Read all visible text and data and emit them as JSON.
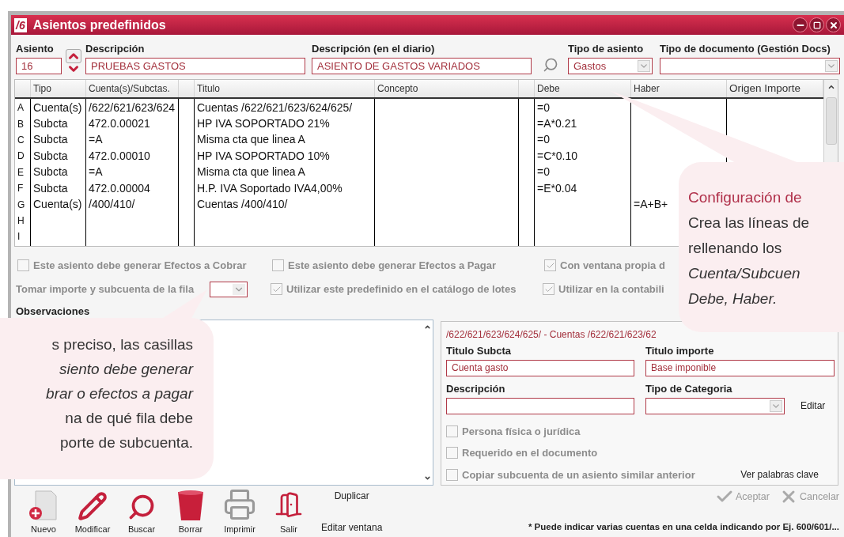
{
  "window": {
    "logo": "/6",
    "title": "Asientos predefinidos"
  },
  "header": {
    "asiento": {
      "label": "Asiento",
      "value": "16"
    },
    "descripcion": {
      "label": "Descripción",
      "value": "PRUEBAS GASTOS"
    },
    "descripcion_diario": {
      "label": "Descripción (en el diario)",
      "value": "ASIENTO DE GASTOS VARIADOS"
    },
    "tipo_asiento": {
      "label": "Tipo de asiento",
      "value": "Gastos"
    },
    "tipo_documento": {
      "label": "Tipo de documento (Gestión Docs)"
    }
  },
  "table": {
    "columns": [
      "Tipo",
      "Cuenta(s)/Subctas.",
      "Titulo",
      "Concepto",
      "Debe",
      "Haber",
      "Origen Importe"
    ],
    "rows": [
      {
        "row": "A",
        "tipo": "Cuenta(s)",
        "cuenta": "/622/621/623/624",
        "titulo": "Cuentas /622/621/623/624/625/",
        "debe": "=0"
      },
      {
        "row": "B",
        "tipo": "Subcta",
        "cuenta": "472.0.00021",
        "titulo": "HP IVA SOPORTADO 21%",
        "debe": "=A*0.21"
      },
      {
        "row": "C",
        "tipo": "Subcta",
        "cuenta": "=A",
        "titulo": "Misma cta que linea A",
        "debe": "=0"
      },
      {
        "row": "D",
        "tipo": "Subcta",
        "cuenta": "472.0.00010",
        "titulo": "HP IVA SOPORTADO 10%",
        "debe": "=C*0.10"
      },
      {
        "row": "E",
        "tipo": "Subcta",
        "cuenta": "=A",
        "titulo": "Misma cta que linea A",
        "debe": "=0"
      },
      {
        "row": "F",
        "tipo": "Subcta",
        "cuenta": "472.0.00004",
        "titulo": "H.P. IVA Soportado IVA4,00%",
        "debe": "=E*0.04"
      },
      {
        "row": "G",
        "tipo": "Cuenta(s)",
        "cuenta": "/400/410/",
        "titulo": "Cuentas /400/410/",
        "haber": "=A+B+"
      },
      {
        "row": "H"
      },
      {
        "row": "I"
      }
    ]
  },
  "options_row1": [
    {
      "label": "Este asiento debe generar Efectos a Cobrar",
      "checked": false,
      "disabled": true
    },
    {
      "label": "Este asiento debe generar Efectos a Pagar",
      "checked": false,
      "disabled": true
    },
    {
      "label": "Con ventana propia d",
      "checked": true,
      "disabled": true
    }
  ],
  "fila_selector": {
    "label": "Tomar importe y subcuenta de la fila"
  },
  "options_row2": [
    {
      "label": "Utilizar este predefinido en el catálogo de lotes",
      "checked": true,
      "disabled": true
    },
    {
      "label": "Utilizar en la contabili",
      "checked": true,
      "disabled": true
    }
  ],
  "observaciones": {
    "label": "Observaciones"
  },
  "line_panel": {
    "heading": "/622/621/623/624/625/ - Cuentas /622/621/623/62",
    "titulo_subcta": {
      "label": "Titulo Subcta",
      "value": "Cuenta gasto"
    },
    "titulo_importe": {
      "label": "Titulo importe",
      "value": "Base imponible"
    },
    "descripcion": {
      "label": "Descripción"
    },
    "tipo_categoria": {
      "label": "Tipo de Categoria"
    },
    "edit_link": "Editar",
    "checkboxes": [
      {
        "label": "Persona física o jurídica",
        "checked": false,
        "disabled": true
      },
      {
        "label": "Requerido en el documento",
        "checked": false,
        "disabled": true
      },
      {
        "label": "Copiar subcuenta de un asiento similar anterior",
        "checked": false,
        "disabled": true
      }
    ],
    "keywords_link": "Ver palabras clave"
  },
  "toolbar": [
    {
      "label": "Nuevo",
      "kind": "new"
    },
    {
      "label": "Modificar",
      "kind": "edit"
    },
    {
      "label": "Buscar",
      "kind": "search"
    },
    {
      "label": "Borrar",
      "kind": "delete"
    },
    {
      "label": "Imprimir",
      "kind": "print"
    },
    {
      "label": "Salir",
      "kind": "exit"
    }
  ],
  "links": [
    "Duplicar",
    "Editar ventana"
  ],
  "actions": [
    {
      "label": "Aceptar",
      "kind": "accept",
      "disabled": true
    },
    {
      "label": "Cancelar",
      "kind": "cancel",
      "disabled": true
    }
  ],
  "footnote": "* Puede indicar varias cuentas en una celda indicando por Ej. 600/601/...",
  "callouts": {
    "right": {
      "title": "Configuración de",
      "lines": [
        "Crea las líneas de",
        "rellenando los",
        "*Cuenta/Subcuen*",
        "*Debe, Haber.*"
      ]
    },
    "left": {
      "lines": [
        "s preciso, las casillas",
        "*siento debe generar*",
        "*brar o efectos a pagar*",
        "na de qué fila debe",
        "porte de subcuenta."
      ]
    }
  }
}
